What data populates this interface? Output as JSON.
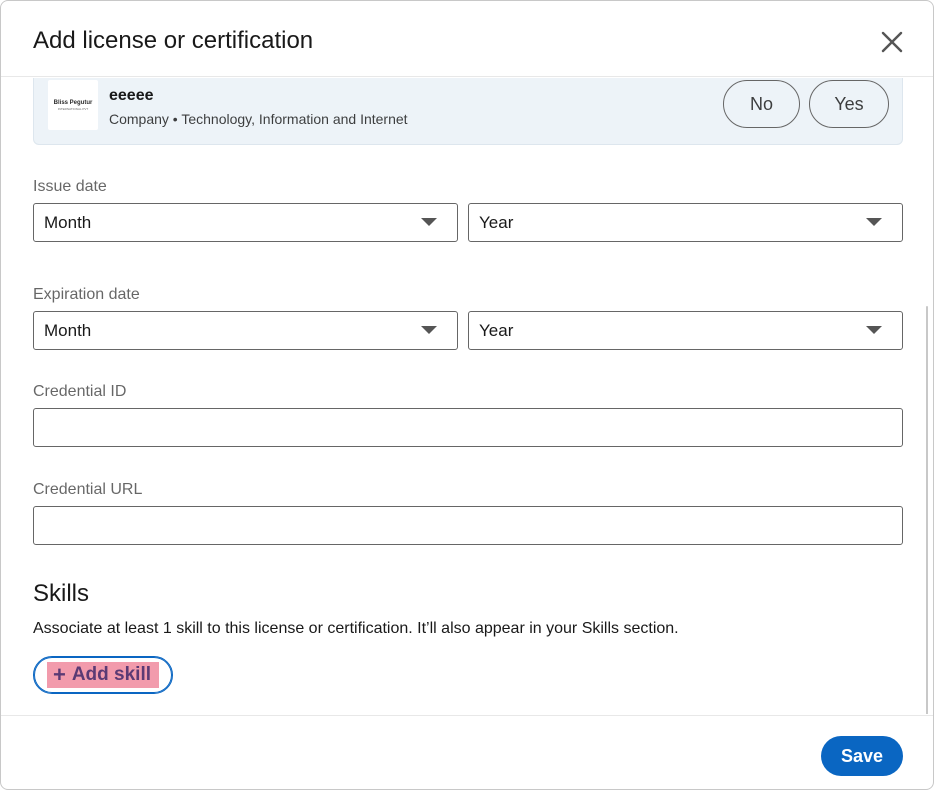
{
  "dialog": {
    "title": "Add license or certification"
  },
  "organization": {
    "logo_text": "Bliss Pegutur",
    "logo_sub": "INTERNATIONAL PVT",
    "name": "eeeee",
    "meta": "Company • Technology, Information and Internet",
    "no_label": "No",
    "yes_label": "Yes"
  },
  "issue_date": {
    "label": "Issue date",
    "month": "Month",
    "year": "Year"
  },
  "expiration_date": {
    "label": "Expiration date",
    "month": "Month",
    "year": "Year"
  },
  "credential_id": {
    "label": "Credential ID",
    "value": ""
  },
  "credential_url": {
    "label": "Credential URL",
    "value": ""
  },
  "skills": {
    "title": "Skills",
    "description": "Associate at least 1 skill to this license or certification. It’ll also appear in your Skills section.",
    "add_label": "Add skill",
    "plus": "+"
  },
  "footer": {
    "save_label": "Save"
  },
  "colors": {
    "primary": "#0a66c2",
    "card_bg": "#edf3f8",
    "highlight": "#f29bac"
  }
}
